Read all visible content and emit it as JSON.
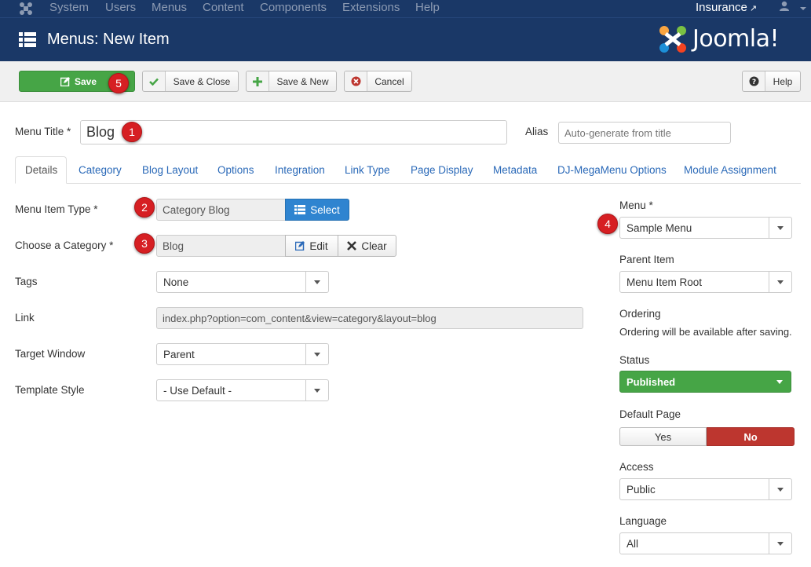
{
  "topnav": {
    "items": [
      "System",
      "Users",
      "Menus",
      "Content",
      "Components",
      "Extensions",
      "Help"
    ],
    "site_name": "Insurance"
  },
  "header": {
    "title": "Menus: New Item",
    "brand": "Joomla!"
  },
  "toolbar": {
    "save": "Save",
    "save_close": "Save & Close",
    "save_new": "Save & New",
    "cancel": "Cancel",
    "help": "Help"
  },
  "markers": [
    "1",
    "2",
    "3",
    "4",
    "5"
  ],
  "form": {
    "menu_title_label": "Menu Title *",
    "menu_title_value": "Blog",
    "alias_label": "Alias",
    "alias_placeholder": "Auto-generate from title"
  },
  "tabs": [
    "Details",
    "Category",
    "Blog Layout",
    "Options",
    "Integration",
    "Link Type",
    "Page Display",
    "Metadata",
    "DJ-MegaMenu Options",
    "Module Assignment"
  ],
  "details": {
    "menu_item_type_label": "Menu Item Type *",
    "menu_item_type_value": "Category Blog",
    "select_label": "Select",
    "category_label": "Choose a Category *",
    "category_value": "Blog",
    "edit_label": "Edit",
    "clear_label": "Clear",
    "tags_label": "Tags",
    "tags_value": "None",
    "link_label": "Link",
    "link_value": "index.php?option=com_content&view=category&layout=blog",
    "target_label": "Target Window",
    "target_value": "Parent",
    "template_label": "Template Style",
    "template_value": "- Use Default -"
  },
  "sidebar": {
    "menu_label": "Menu *",
    "menu_value": "Sample Menu",
    "parent_label": "Parent Item",
    "parent_value": "Menu Item Root",
    "ordering_label": "Ordering",
    "ordering_text": "Ordering will be available after saving.",
    "status_label": "Status",
    "status_value": "Published",
    "default_label": "Default Page",
    "default_yes": "Yes",
    "default_no": "No",
    "access_label": "Access",
    "access_value": "Public",
    "language_label": "Language",
    "language_value": "All"
  },
  "colors": {
    "header_bg": "#1a3867",
    "save_green": "#46a546",
    "select_blue": "#2f84d0",
    "marker_red": "#d61f23",
    "no_red": "#bd362f"
  }
}
